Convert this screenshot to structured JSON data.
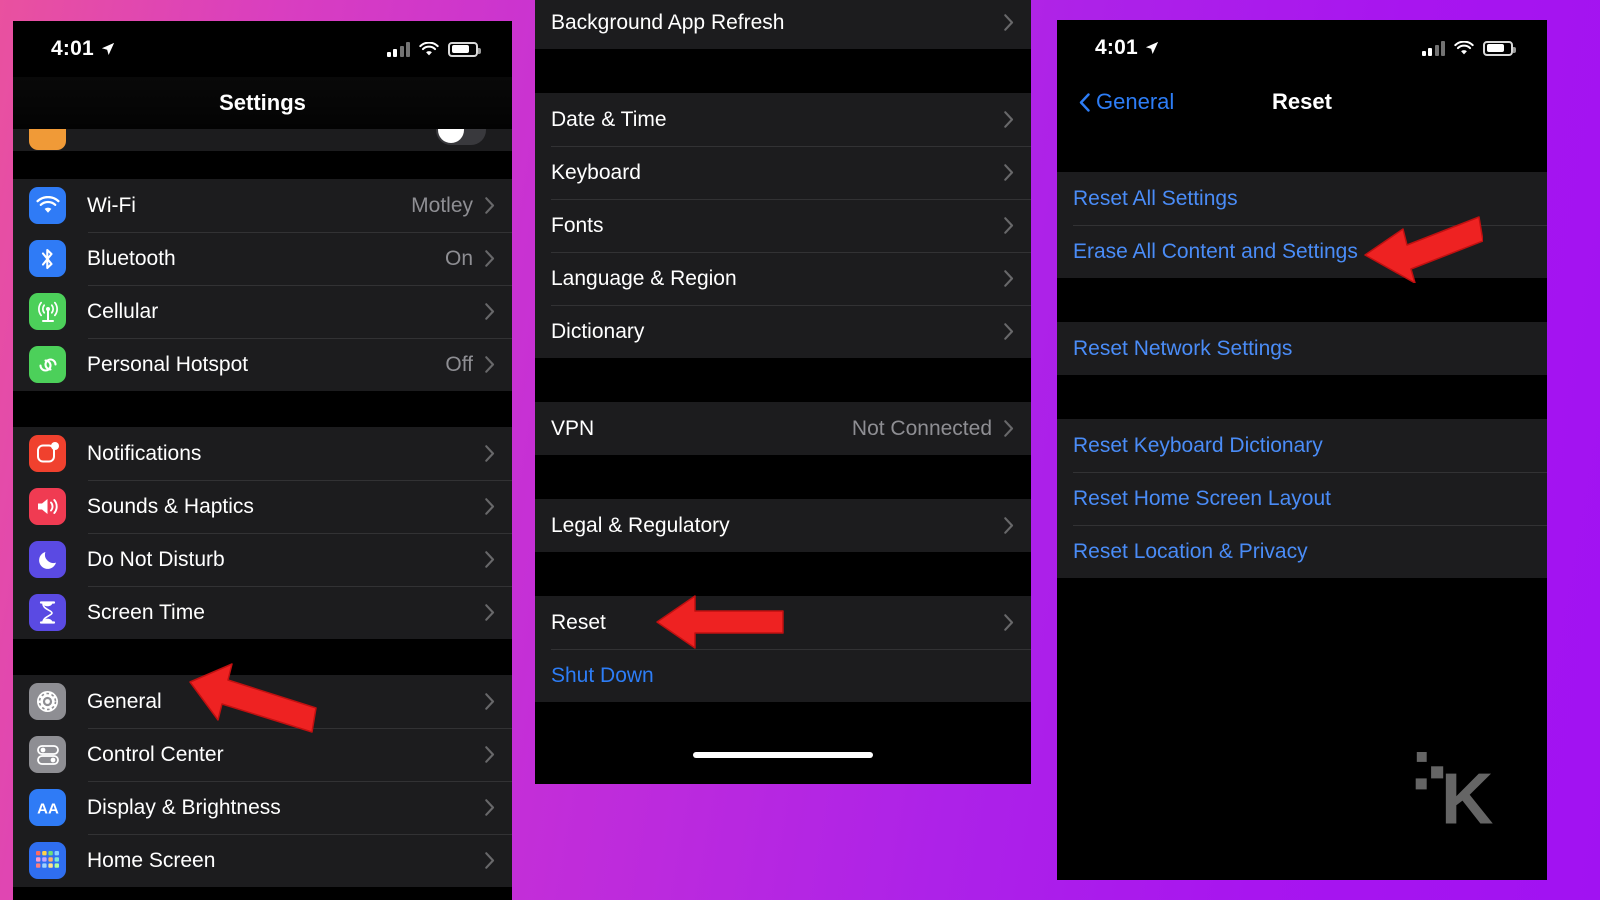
{
  "background": {
    "from": "#e9519f",
    "to": "#a112f2"
  },
  "colors": {
    "ios_blue": "#2d7df6",
    "link_blue": "#4a8cf7",
    "row_bg": "#1c1c1e",
    "separator": "#323234",
    "secondary_text": "#8e8e93",
    "arrow_red": "#ee2222"
  },
  "phone1": {
    "status": {
      "time": "4:01",
      "location_icon": "location-arrow-icon",
      "signal_icon": "cellular-bars-icon",
      "wifi_icon": "wifi-icon",
      "battery_icon": "battery-icon"
    },
    "nav": {
      "title": "Settings"
    },
    "groups": [
      {
        "id": "connectivity",
        "rows": [
          {
            "label": "Wi-Fi",
            "value": "Motley",
            "icon": "wifi-icon",
            "icon_color": "#2f7bf6",
            "chevron": true
          },
          {
            "label": "Bluetooth",
            "value": "On",
            "icon": "bluetooth-icon",
            "icon_color": "#2f7bf6",
            "chevron": true
          },
          {
            "label": "Cellular",
            "value": "",
            "icon": "cellular-antenna-icon",
            "icon_color": "#4cd05a",
            "chevron": true
          },
          {
            "label": "Personal Hotspot",
            "value": "Off",
            "icon": "hotspot-link-icon",
            "icon_color": "#4cd05a",
            "chevron": true
          }
        ]
      },
      {
        "id": "alerts",
        "rows": [
          {
            "label": "Notifications",
            "value": "",
            "icon": "notifications-icon",
            "icon_color": "#f0412e",
            "chevron": true
          },
          {
            "label": "Sounds & Haptics",
            "value": "",
            "icon": "speaker-icon",
            "icon_color": "#f03b52",
            "chevron": true
          },
          {
            "label": "Do Not Disturb",
            "value": "",
            "icon": "moon-icon",
            "icon_color": "#5a4ae3",
            "chevron": true
          },
          {
            "label": "Screen Time",
            "value": "",
            "icon": "hourglass-icon",
            "icon_color": "#5a4ae3",
            "chevron": true
          }
        ]
      },
      {
        "id": "system",
        "rows": [
          {
            "label": "General",
            "value": "",
            "icon": "gear-icon",
            "icon_color": "#8e8e93",
            "chevron": true
          },
          {
            "label": "Control Center",
            "value": "",
            "icon": "control-center-icon",
            "icon_color": "#8e8e93",
            "chevron": true
          },
          {
            "label": "Display & Brightness",
            "value": "",
            "icon": "display-aa-icon",
            "icon_color": "#2f7bf6",
            "chevron": true
          },
          {
            "label": "Home Screen",
            "value": "",
            "icon": "home-screen-grid-icon",
            "icon_color": "#2f6ef0",
            "chevron": true
          }
        ]
      }
    ]
  },
  "phone2": {
    "groups": [
      {
        "id": "g1",
        "rows": [
          {
            "label": "Background App Refresh",
            "value": "",
            "chevron": true
          }
        ]
      },
      {
        "id": "g2",
        "rows": [
          {
            "label": "Date & Time",
            "value": "",
            "chevron": true
          },
          {
            "label": "Keyboard",
            "value": "",
            "chevron": true
          },
          {
            "label": "Fonts",
            "value": "",
            "chevron": true
          },
          {
            "label": "Language & Region",
            "value": "",
            "chevron": true
          },
          {
            "label": "Dictionary",
            "value": "",
            "chevron": true
          }
        ]
      },
      {
        "id": "g3",
        "rows": [
          {
            "label": "VPN",
            "value": "Not Connected",
            "chevron": true
          }
        ]
      },
      {
        "id": "g4",
        "rows": [
          {
            "label": "Legal & Regulatory",
            "value": "",
            "chevron": true
          }
        ]
      },
      {
        "id": "g5",
        "rows": [
          {
            "label": "Reset",
            "value": "",
            "chevron": true
          },
          {
            "label": "Shut Down",
            "value": "",
            "chevron": false,
            "style": "blue"
          }
        ]
      }
    ],
    "home_indicator": true
  },
  "phone3": {
    "status": {
      "time": "4:01",
      "location_icon": "location-arrow-icon",
      "signal_icon": "cellular-bars-icon",
      "wifi_icon": "wifi-icon",
      "battery_icon": "battery-icon"
    },
    "nav": {
      "back_label": "General",
      "back_icon": "chevron-left-icon",
      "title": "Reset"
    },
    "groups": [
      {
        "id": "r1",
        "rows": [
          {
            "label": "Reset All Settings"
          },
          {
            "label": "Erase All Content and Settings"
          }
        ]
      },
      {
        "id": "r2",
        "rows": [
          {
            "label": "Reset Network Settings"
          }
        ]
      },
      {
        "id": "r3",
        "rows": [
          {
            "label": "Reset Keyboard Dictionary"
          },
          {
            "label": "Reset Home Screen Layout"
          },
          {
            "label": "Reset Location & Privacy"
          }
        ]
      }
    ],
    "watermark": {
      "text": "K",
      "name": "k-logo-watermark"
    }
  },
  "annotations": [
    {
      "id": "arrow-general",
      "points_to": "General",
      "direction": "left",
      "color": "#ee2222"
    },
    {
      "id": "arrow-reset",
      "points_to": "Reset",
      "direction": "left",
      "color": "#ee2222"
    },
    {
      "id": "arrow-erase",
      "points_to": "Erase All Content and Settings",
      "direction": "left",
      "color": "#ee2222"
    }
  ]
}
